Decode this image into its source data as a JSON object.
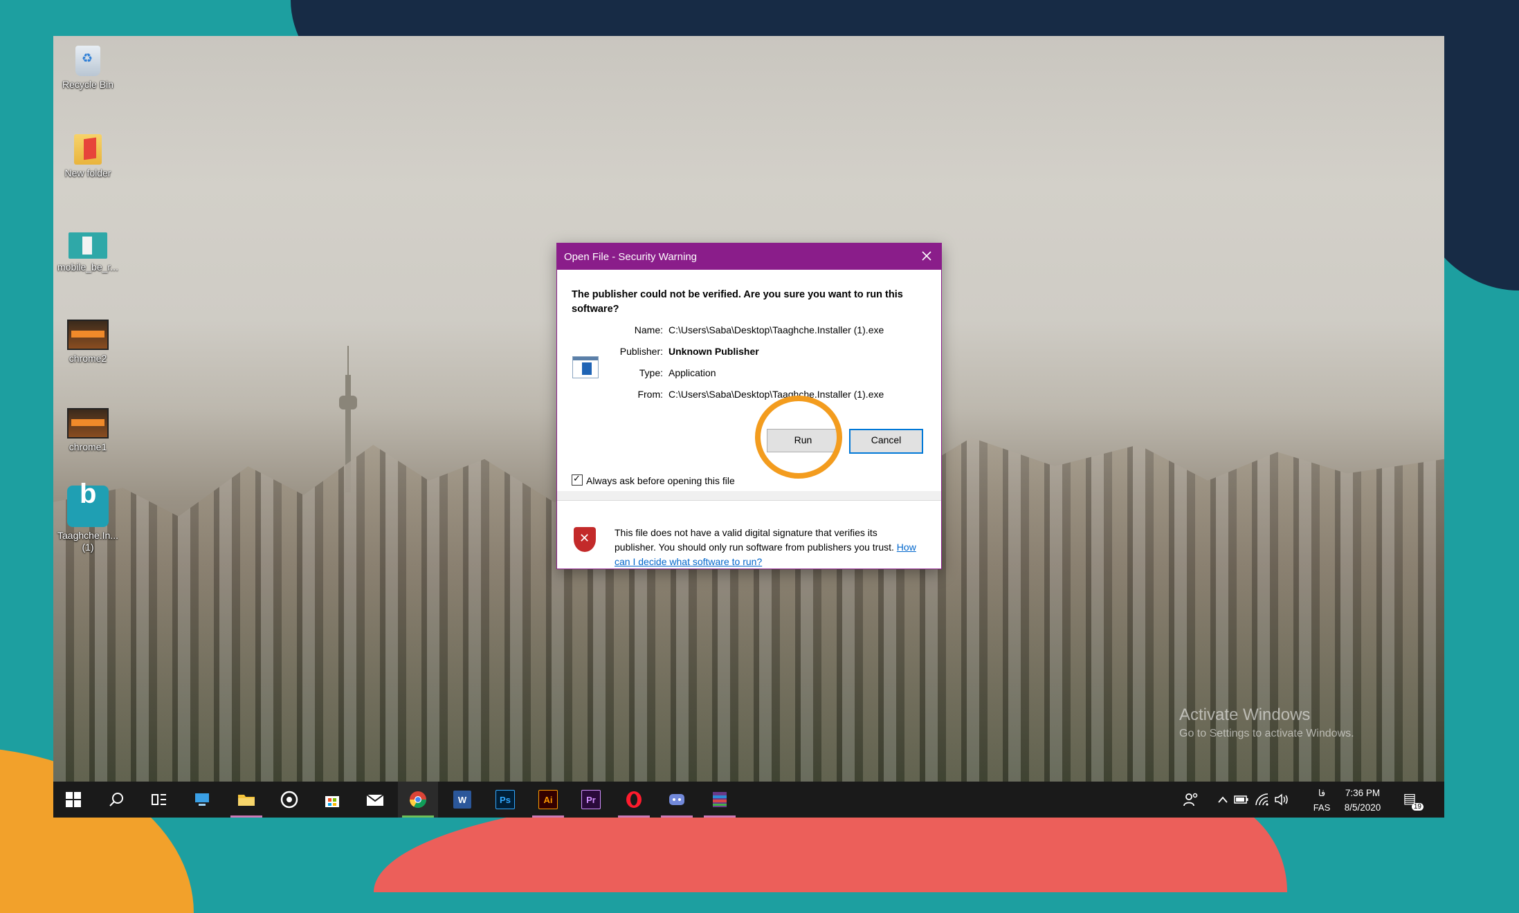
{
  "desktop": {
    "icons": [
      {
        "label": "Recycle Bin",
        "icon": "recycle-bin-icon"
      },
      {
        "label": "New folder",
        "icon": "folder-icon"
      },
      {
        "label": "mobile_be_r...",
        "icon": "image-icon"
      },
      {
        "label": "chrome2",
        "icon": "image-icon"
      },
      {
        "label": "chrome1",
        "icon": "image-icon"
      },
      {
        "label": "Taaghche.In... (1)",
        "icon": "taaghche-app-icon"
      }
    ],
    "watermark": {
      "line1": "Activate Windows",
      "line2": "Go to Settings to activate Windows."
    }
  },
  "dialog": {
    "title": "Open File - Security Warning",
    "question": "The publisher could not be verified.  Are you sure you want to run this software?",
    "fields": [
      {
        "key": "Name:",
        "value": "C:\\Users\\Saba\\Desktop\\Taaghche.Installer (1).exe"
      },
      {
        "key": "Publisher:",
        "value": "Unknown Publisher"
      },
      {
        "key": "Type:",
        "value": "Application"
      },
      {
        "key": "From:",
        "value": "C:\\Users\\Saba\\Desktop\\Taaghche.Installer (1).exe"
      }
    ],
    "run_label": "Run",
    "cancel_label": "Cancel",
    "checkbox_label": "Always ask before opening this file",
    "checkbox_checked": true,
    "warning_text": "This file does not have a valid digital signature that verifies its publisher.  You should only run software from publishers you trust.",
    "help_link": "How can I decide what software to run?"
  },
  "taskbar": {
    "apps": [
      {
        "name": "file-explorer",
        "running": true
      },
      {
        "name": "media",
        "running": false
      },
      {
        "name": "store",
        "running": false
      },
      {
        "name": "mail",
        "running": false
      },
      {
        "name": "chrome",
        "running": true,
        "active": true
      },
      {
        "name": "word",
        "label": "W",
        "running": false
      },
      {
        "name": "photoshop",
        "label": "Ps",
        "running": false
      },
      {
        "name": "illustrator",
        "label": "Ai",
        "running": true
      },
      {
        "name": "premiere",
        "label": "Pr",
        "running": false
      },
      {
        "name": "opera",
        "running": true
      },
      {
        "name": "discord",
        "running": true
      },
      {
        "name": "winrar",
        "running": true
      }
    ],
    "lang_top": "فا",
    "lang_bottom": "FAS",
    "time": "7:36 PM",
    "date": "8/5/2020",
    "notification_count": "19"
  },
  "colors": {
    "dialog_title": "#8a1d8a",
    "highlight_ring": "#f39c1e",
    "taskbar": "#1a1a1a"
  }
}
